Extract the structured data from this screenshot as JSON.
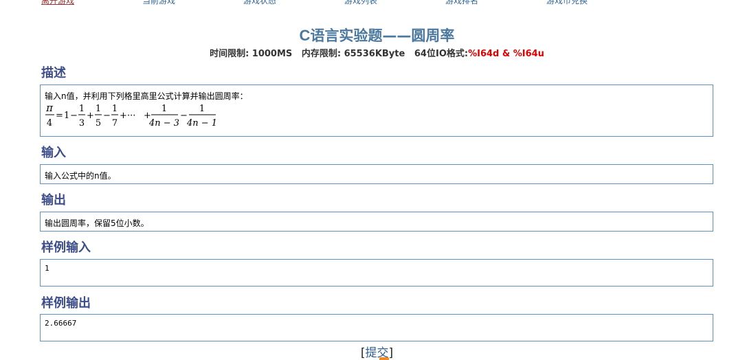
{
  "nav": {
    "items": [
      {
        "label": "离开游戏",
        "active": true
      },
      {
        "label": "当前游戏",
        "active": false
      },
      {
        "label": "游戏状态",
        "active": false
      },
      {
        "label": "游戏列表",
        "active": false
      },
      {
        "label": "游戏排名",
        "active": false
      },
      {
        "label": "游戏币兑换",
        "active": false
      }
    ]
  },
  "problem": {
    "title_prefix": "C",
    "title_rest": "语言实验题——圆周率",
    "limits": {
      "time_label": "时间限制:",
      "time_value": "1000MS",
      "memory_label": "内存限制:",
      "memory_value": "65536KByte",
      "io_label": "64位IO格式:",
      "io_value": "%I64d & %I64u"
    }
  },
  "sections": {
    "description": {
      "heading": "描述",
      "text": "输入n值，并利用下列格里高里公式计算并输出圆周率：",
      "formula": {
        "lhs_num": "π",
        "lhs_den": "4",
        "equals": "=",
        "one": "1",
        "minus": "−",
        "plus": "+",
        "ellipsis": "···",
        "num": "1",
        "den3": "3",
        "den5": "5",
        "den7": "7",
        "den_4n3": "4n − 3",
        "den_4n1": "4n − 1"
      }
    },
    "input": {
      "heading": "输入",
      "text": "输入公式中的n值。"
    },
    "output": {
      "heading": "输出",
      "text": "输出圆周率，保留5位小数。"
    },
    "sample_input": {
      "heading": "样例输入",
      "text": "1"
    },
    "sample_output": {
      "heading": "样例输出",
      "text": "2.66667"
    }
  },
  "submit": {
    "open_bracket": "[",
    "label": "提交",
    "close_bracket": "]"
  }
}
